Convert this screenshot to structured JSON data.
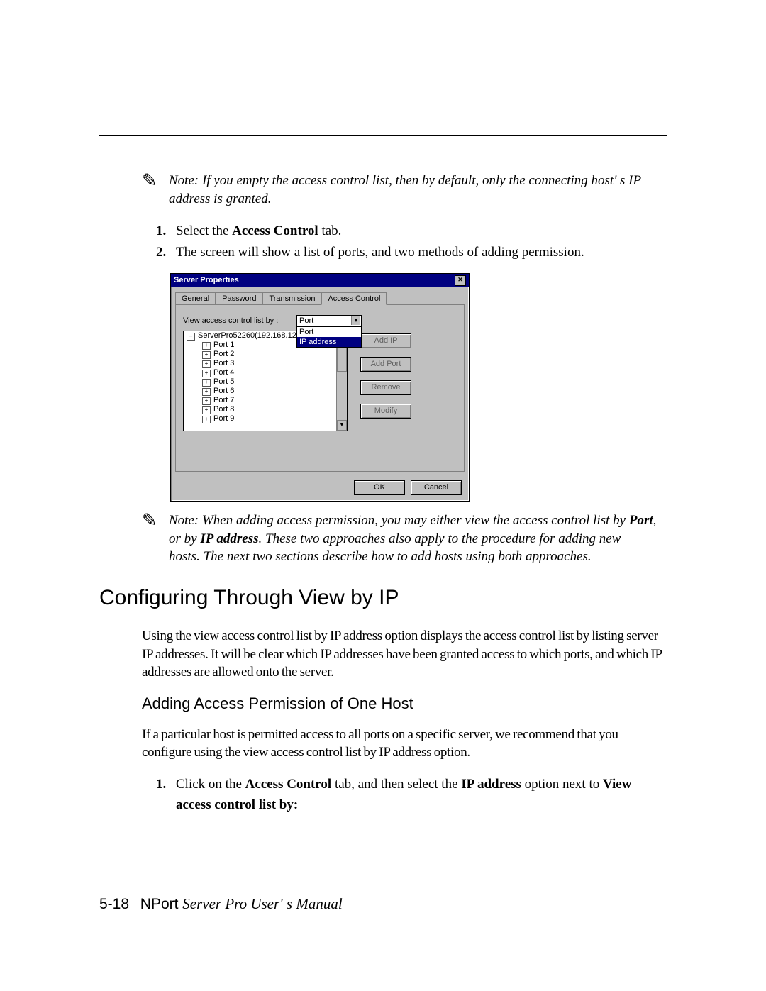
{
  "note1_lead": "Note: If you empty the access control list, then by default, only the connecting host' s IP",
  "note1_cont": "address is granted.",
  "steps1": [
    {
      "n": "1.",
      "pre": "Select the ",
      "bold": "Access Control",
      "post": " tab."
    },
    {
      "n": "2.",
      "pre": "The screen will show a list of ports, and two methods of adding permission.",
      "bold": "",
      "post": ""
    }
  ],
  "dialog": {
    "title": "Server Properties",
    "close": "✕",
    "tabs": [
      "General",
      "Password",
      "Transmission",
      "Access Control"
    ],
    "active_tab": 3,
    "view_label": "View access control list by :",
    "combo_selected": "Port",
    "combo_options": [
      "Port",
      "IP address"
    ],
    "tree_root": "ServerPro52260(192.168.127.254)",
    "tree_items": [
      "Port 1",
      "Port 2",
      "Port 3",
      "Port 4",
      "Port 5",
      "Port 6",
      "Port 7",
      "Port 8",
      "Port 9"
    ],
    "buttons": [
      "Add IP",
      "Add Port",
      "Remove",
      "Modify"
    ],
    "ok": "OK",
    "cancel": "Cancel"
  },
  "note2_l1a": "Note: When adding access permission, you may either view the access control list by ",
  "note2_l1b": "Port",
  "note2_l1c": ",",
  "note2_l2a": "or by ",
  "note2_l2b": "IP address",
  "note2_l2c": ". These two approaches also apply to the procedure for adding new",
  "note2_l3": "hosts. The next two sections describe how to add hosts using both approaches.",
  "h2": "Configuring Through View by IP",
  "p1": "Using the view access control list by IP address option displays the access control list by listing server IP addresses. It will be clear which IP addresses have been granted access to which ports, and which IP addresses are allowed onto the server.",
  "h3": "Adding Access Permission of One Host",
  "p2": "If a particular host is permitted access to all ports on a specific server, we recommend that you configure using the view access control list by IP address option.",
  "step3_n": "1.",
  "step3_a": "Click on the ",
  "step3_b": "Access Control",
  "step3_c": " tab, and then select the ",
  "step3_d": "IP address",
  "step3_e": " option next to ",
  "step3_f": "View access control list by:",
  "footer_page": "5-18",
  "footer_brand": "NPort ",
  "footer_title": "Server Pro User' s Manual"
}
